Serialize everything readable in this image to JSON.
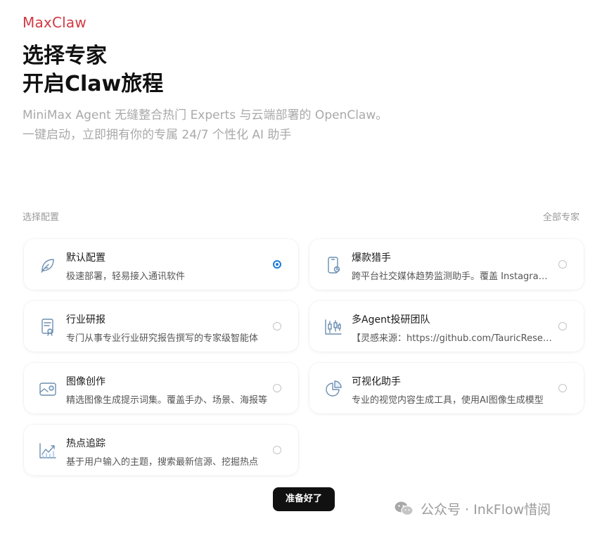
{
  "brand": "MaxClaw",
  "hero": {
    "title_line1": "选择专家",
    "title_line2": "开启Claw旅程",
    "subtitle_line1": "MiniMax Agent 无缝整合热门 Experts 与云端部署的 OpenClaw。",
    "subtitle_line2": "一键启动，立即拥有你的专属 24/7 个性化 AI 助手"
  },
  "section": {
    "label": "选择配置",
    "all_experts": "全部专家"
  },
  "accent_color": "#1e7bd8",
  "brand_color": "#d23a44",
  "experts": [
    {
      "title": "默认配置",
      "desc": "极速部署，轻易接入通讯软件",
      "icon": "leaf-icon",
      "selected": true
    },
    {
      "title": "爆款猎手",
      "desc": "跨平台社交媒体趋势监测助手。覆盖 Instagram、TikTok...",
      "icon": "phone-chart-icon",
      "selected": false
    },
    {
      "title": "行业研报",
      "desc": "专门从事专业行业研究报告撰写的专家级智能体",
      "icon": "report-icon",
      "selected": false
    },
    {
      "title": "多Agent投研团队",
      "desc": "【灵感来源：https://github.com/TauricResearch】",
      "icon": "candlestick-icon",
      "selected": false
    },
    {
      "title": "图像创作",
      "desc": "精选图像生成提示词集。覆盖手办、场景、海报等",
      "icon": "image-icon",
      "selected": false
    },
    {
      "title": "可视化助手",
      "desc": "专业的视觉内容生成工具，使用AI图像生成模型",
      "icon": "pie-chart-icon",
      "selected": false
    },
    {
      "title": "热点追踪",
      "desc": "基于用户输入的主题，搜索最新信源、挖掘热点",
      "icon": "trend-chart-icon",
      "selected": false
    }
  ],
  "ready_button": "准备好了",
  "watermark": "公众号 · InkFlow惜阅"
}
